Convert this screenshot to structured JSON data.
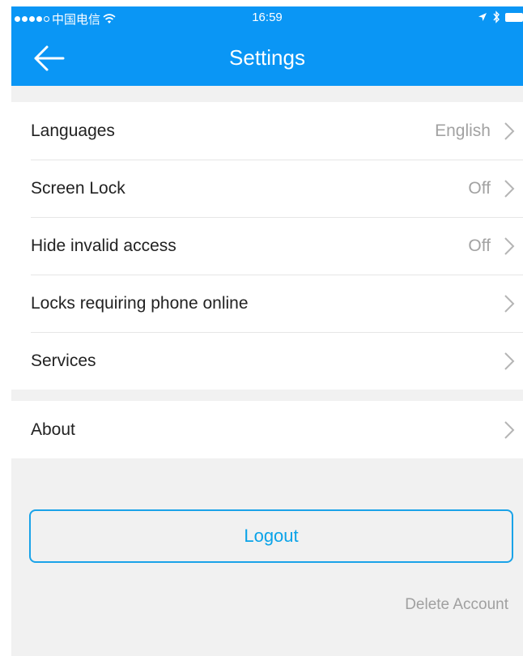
{
  "status_bar": {
    "carrier": "中国电信",
    "time": "16:59",
    "signal_icon": "signal-dots-icon",
    "wifi_icon": "wifi-icon",
    "location_icon": "location-arrow-icon",
    "bluetooth_icon": "bluetooth-icon",
    "battery_icon": "battery-icon"
  },
  "header": {
    "title": "Settings",
    "back_icon": "arrow-left-icon",
    "color": "#0a96f5"
  },
  "settings": {
    "items": [
      {
        "label": "Languages",
        "value": "English"
      },
      {
        "label": "Screen Lock",
        "value": "Off"
      },
      {
        "label": "Hide invalid access",
        "value": "Off"
      },
      {
        "label": "Locks requiring phone online",
        "value": ""
      },
      {
        "label": "Services",
        "value": ""
      }
    ],
    "about": {
      "label": "About"
    },
    "chevron_icon": "chevron-right-icon"
  },
  "account": {
    "logout_label": "Logout",
    "delete_label": "Delete Account",
    "accent": "#0aa3e8"
  }
}
